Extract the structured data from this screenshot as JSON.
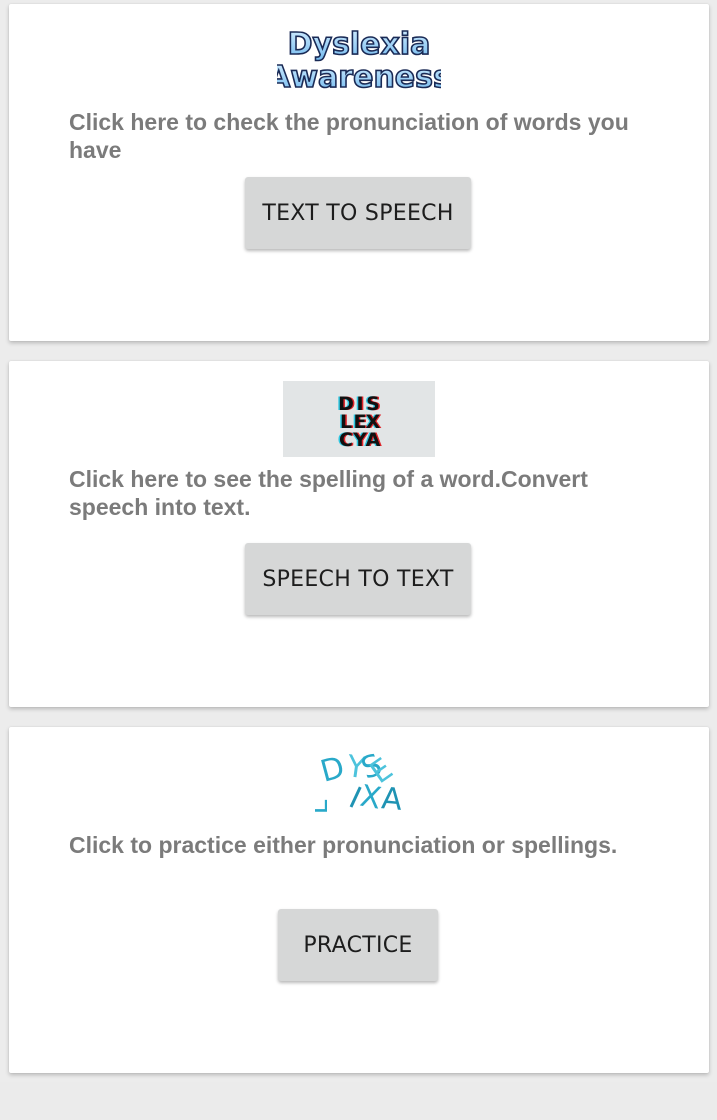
{
  "cards": [
    {
      "logo": {
        "text_line1": "Dyslexia",
        "text_line2": "Awareness"
      },
      "description": "Click here to check the pronunciation of words you have",
      "button_label": "TEXT TO SPEECH"
    },
    {
      "logo": {
        "row1": [
          "D",
          "I",
          "S"
        ],
        "row2": [
          "L",
          "E",
          "X"
        ],
        "row3": [
          "C",
          "Y",
          "A"
        ]
      },
      "description": "Click here to see the spelling of a word.Convert speech into text.",
      "button_label": "SPEECH TO TEXT"
    },
    {
      "logo": {
        "row1": [
          "D",
          "Y",
          "S",
          "L"
        ],
        "row2": [
          "E",
          "X",
          "I",
          "A"
        ]
      },
      "description": "Click to practice either pronunciation or spellings.",
      "button_label": "PRACTICE"
    }
  ],
  "colors": {
    "background": "#ececec",
    "card": "#ffffff",
    "button": "#d6d7d7",
    "button_text": "#1d1d1d",
    "description_text": "#7b7b7b",
    "logo1_fill": "#9fd3f5",
    "logo2_red": "#e0242a",
    "logo2_cyan": "#2dc6e0",
    "logo3_teal": "#29a9c9"
  },
  "icons": {
    "logo1": "dyslexia-awareness-logo",
    "logo2": "dyslexia-block-letters-logo",
    "logo3": "dyslexia-scattered-letters-logo"
  }
}
